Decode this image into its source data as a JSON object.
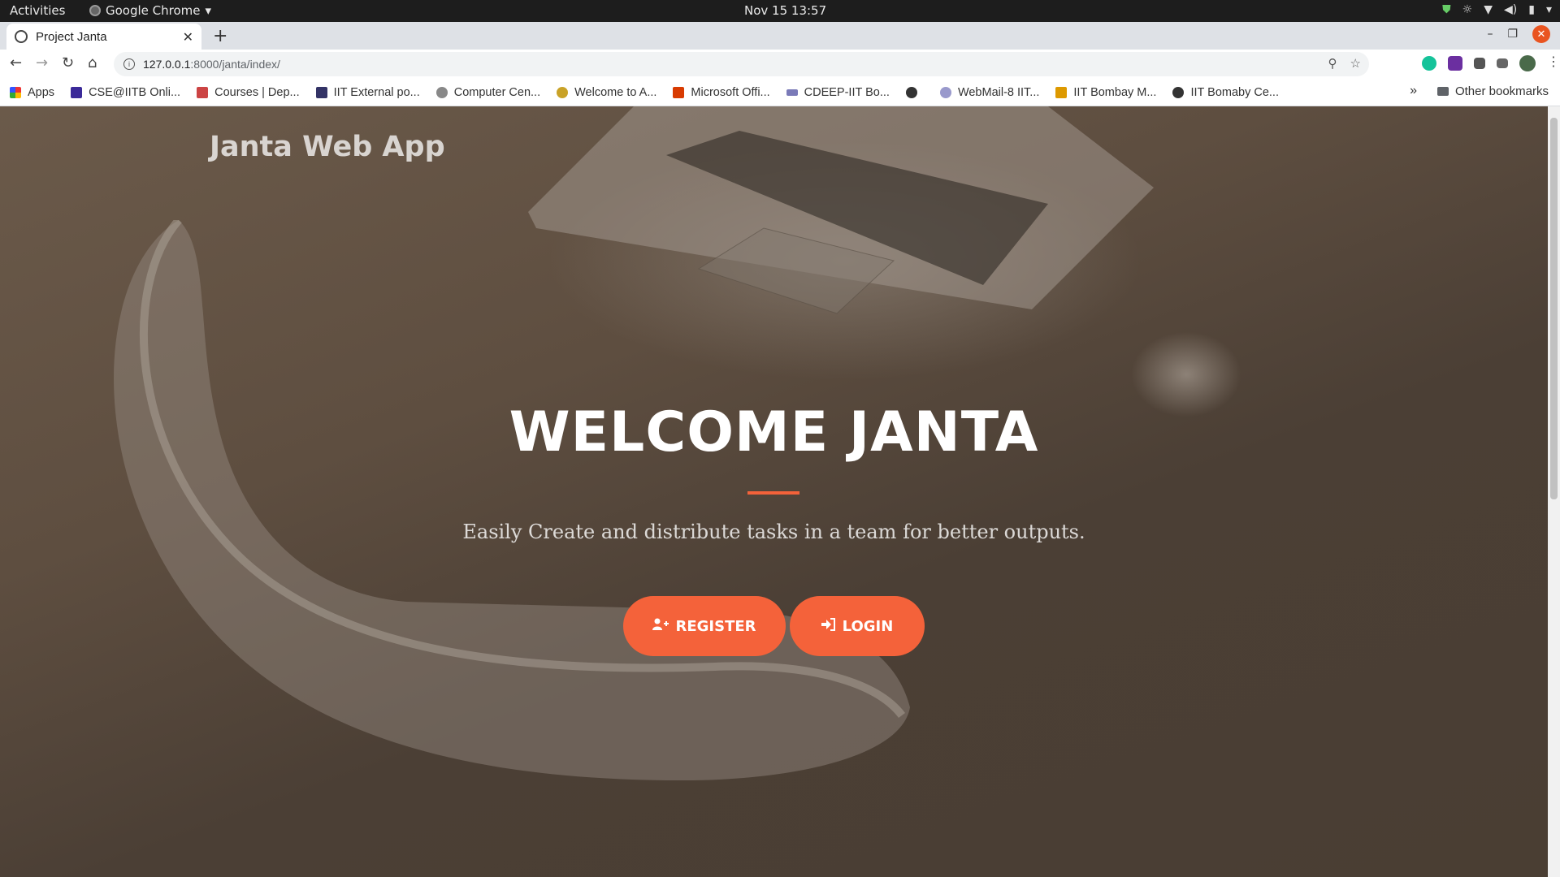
{
  "os_bar": {
    "activities": "Activities",
    "app_name": "Google Chrome",
    "clock": "Nov 15  13:57"
  },
  "browser": {
    "tab_title": "Project Janta",
    "url_host": "127.0.0.1",
    "url_path": ":8000/janta/index/",
    "bookmarks": [
      "Apps",
      "CSE@IITB Onli...",
      "Courses | Dep...",
      "IIT External po...",
      "Computer Cen...",
      "Welcome to A...",
      "Microsoft Offi...",
      "CDEEP-IIT Bo...",
      "",
      "WebMail-8 IIT...",
      "IIT Bombay M...",
      "IIT Bomaby Ce..."
    ],
    "bookmarks_more": "»",
    "other_bookmarks": "Other bookmarks"
  },
  "page": {
    "brand": "Janta Web App",
    "hero_title": "WELCOME JANTA",
    "subtitle": "Easily Create and distribute tasks in a team for better outputs.",
    "register_label": "REGISTER",
    "login_label": "LOGIN",
    "accent_color": "#f4623a"
  }
}
